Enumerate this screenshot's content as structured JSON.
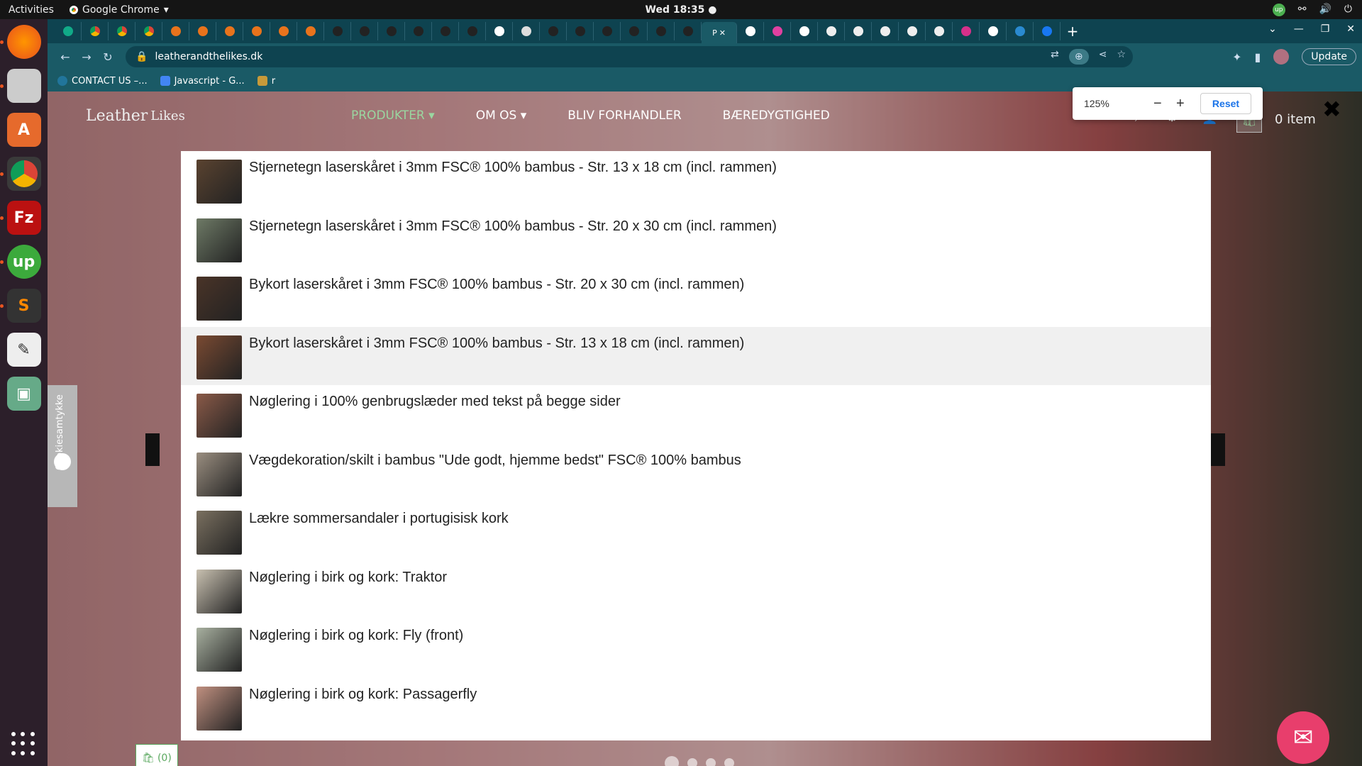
{
  "topbar": {
    "activities": "Activities",
    "app_name": "Google Chrome",
    "clock": "Wed 18:35 ●"
  },
  "browser": {
    "url": "leatherandthelikes.dk",
    "update_label": "Update",
    "active_tab_label": "P",
    "bookmarks": [
      {
        "label": "CONTACT US –..."
      },
      {
        "label": "Javascript - G..."
      },
      {
        "label": "r"
      }
    ]
  },
  "zoom_popup": {
    "level": "125%",
    "minus": "−",
    "plus": "+",
    "reset_label": "Reset"
  },
  "site": {
    "logo_text": "Leather",
    "logo_text2": "Likes",
    "menu": [
      {
        "label": "PRODUKTER ▾"
      },
      {
        "label": "OM OS ▾"
      },
      {
        "label": "BLIV FORHANDLER"
      },
      {
        "label": "BÆREDYGTIGHED"
      }
    ],
    "cart_count": "0 item",
    "cookie_tab": "Cookiesamtykke",
    "mini_cart": "(0)"
  },
  "results": [
    {
      "title": "Stjernetegn laserskåret i 3mm FSC® 100% bambus - Str. 13 x 18 cm (incl. rammen)",
      "color": "#5a4330"
    },
    {
      "title": "Stjernetegn laserskåret i 3mm FSC® 100% bambus - Str. 20 x 30 cm (incl. rammen)",
      "color": "#6e7a66"
    },
    {
      "title": "Bykort laserskåret i 3mm FSC® 100% bambus - Str. 20 x 30 cm (incl. rammen)",
      "color": "#4a3428"
    },
    {
      "title": "Bykort laserskåret i 3mm FSC® 100% bambus - Str. 13 x 18 cm (incl. rammen)",
      "color": "#7a4a32"
    },
    {
      "title": "Nøglering i 100% genbrugslæder med tekst på begge sider",
      "color": "#8a5a48"
    },
    {
      "title": "Vægdekoration/skilt i bambus \"Ude godt, hjemme bedst\" FSC® 100% bambus",
      "color": "#9a8e80"
    },
    {
      "title": "Lækre sommersandaler i portugisisk kork",
      "color": "#7a7060"
    },
    {
      "title": "Nøglering i birk og kork: Traktor",
      "color": "#c8c0b0"
    },
    {
      "title": "Nøglering i birk og kork: Fly (front)",
      "color": "#a8b0a0"
    },
    {
      "title": "Nøglering i birk og kork: Passagerfly",
      "color": "#c09080"
    }
  ]
}
